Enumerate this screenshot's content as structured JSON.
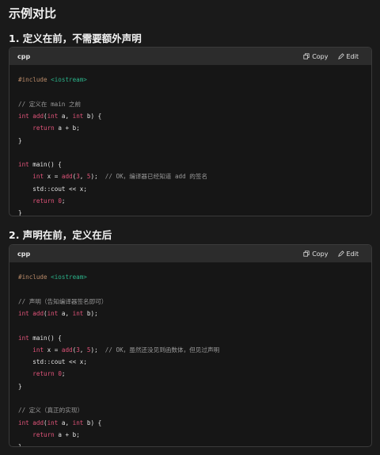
{
  "page": {
    "title": "示例对比"
  },
  "sections": [
    {
      "heading": "1. 定义在前，不需要额外声明",
      "code": {
        "language": "cpp",
        "copy_label": "Copy",
        "edit_label": "Edit",
        "lines": [
          "#include <iostream>",
          "",
          "// 定义在 main 之前",
          "int add(int a, int b) {",
          "    return a + b;",
          "}",
          "",
          "int main() {",
          "    int x = add(3, 5);  // OK，编译器已经知道 add 的签名",
          "    std::cout << x;",
          "    return 0;",
          "}"
        ]
      }
    },
    {
      "heading": "2. 声明在前，定义在后",
      "code": {
        "language": "cpp",
        "copy_label": "Copy",
        "edit_label": "Edit",
        "lines": [
          "#include <iostream>",
          "",
          "// 声明（告知编译器签名即可）",
          "int add(int a, int b);",
          "",
          "int main() {",
          "    int x = add(3, 5);  // OK，虽然还没见到函数体，但见过声明",
          "    std::cout << x;",
          "    return 0;",
          "}",
          "",
          "// 定义（真正的实现）",
          "int add(int a, int b) {",
          "    return a + b;",
          "}"
        ]
      }
    }
  ],
  "colors": {
    "background": "#1a1a1a",
    "code_background": "#161616",
    "header_background": "#2c2c2c",
    "keyword": "#e2547a",
    "preprocessor": "#b98a68",
    "include_target": "#2bb38a",
    "comment": "#9a9a9a"
  },
  "icons": {
    "copy": "copy-icon",
    "edit": "edit-icon"
  }
}
